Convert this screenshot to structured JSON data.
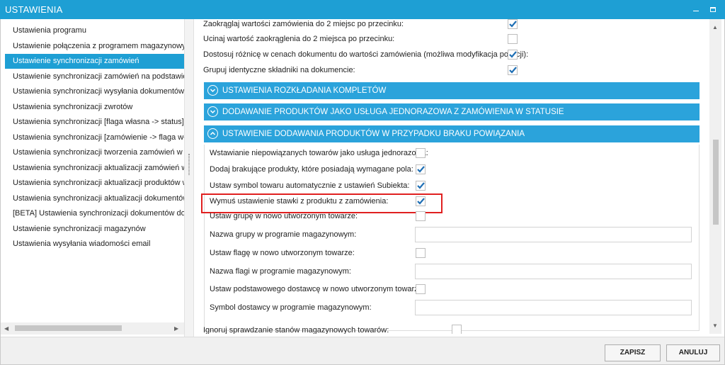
{
  "window": {
    "title": "USTAWIENIA"
  },
  "sidebar": {
    "items": [
      {
        "label": "Ustawienia programu"
      },
      {
        "label": "Ustawienie połączenia z programem magazynowym"
      },
      {
        "label": "Ustawienie synchronizacji zamówień",
        "active": true
      },
      {
        "label": "Ustawienie synchronizacji zamówień na podstawie dzi"
      },
      {
        "label": "Ustawienia synchronizacji wysyłania dokumentów"
      },
      {
        "label": "Ustawienia synchronizacji zwrotów"
      },
      {
        "label": "Ustawienia synchronizacji [flaga własna -> status]"
      },
      {
        "label": "Ustawienia synchronizacji [zamówienie -> flaga własn"
      },
      {
        "label": "Ustawienia synchronizacji tworzenia zamówień w Base"
      },
      {
        "label": "Ustawienia synchronizacji aktualizacji zamówień w Bas"
      },
      {
        "label": "Ustawienia synchronizacji aktualizacji produktów w Ba"
      },
      {
        "label": "Ustawienia synchronizacji aktualizacji dokumentów"
      },
      {
        "label": "[BETA] Ustawienia synchronizacji dokumentów dostaw"
      },
      {
        "label": "Ustawienie synchronizacji magazynów"
      },
      {
        "label": "Ustawienia wysyłania wiadomości email"
      }
    ]
  },
  "top_rows": [
    {
      "label": "Zaokrąglaj wartości zamówienia do 2 miejsc po przecinku:",
      "checked": true
    },
    {
      "label": "Ucinaj wartość zaokrąglenia do 2 miejsca po przecinku:",
      "checked": false
    },
    {
      "label": "Dostosuj różnicę w cenach dokumentu do wartości zamówienia (możliwa modyfikacja pozycji):",
      "checked": true
    },
    {
      "label": "Grupuj identyczne składniki na dokumencie:",
      "checked": true
    }
  ],
  "sections": [
    {
      "label": "USTAWIENIA ROZKŁADANIA KOMPLETÓW",
      "expanded": false
    },
    {
      "label": "DODAWANIE PRODUKTÓW JAKO USŁUGA JEDNORAZOWA Z ZAMÓWIENIA W STATUSIE",
      "expanded": false
    },
    {
      "label": "USTAWIENIE DODAWANIA PRODUKTÓW W PRZYPADKU BRAKU POWIĄZANIA",
      "expanded": true
    }
  ],
  "section_rows": [
    {
      "label": "Wstawianie niepowiązanych towarów jako usługa jednorazowa:",
      "type": "checkbox",
      "checked": false
    },
    {
      "label": "Dodaj brakujące produkty, które posiadają wymagane pola:",
      "type": "checkbox",
      "checked": true
    },
    {
      "label": "Ustaw symbol towaru automatycznie z ustawień Subiekta:",
      "type": "checkbox",
      "checked": true,
      "highlighted": true
    },
    {
      "label": "Wymuś ustawienie stawki z produktu z zamówienia:",
      "type": "checkbox",
      "checked": true
    },
    {
      "label": "Ustaw grupę w nowo utworzonym towarze:",
      "type": "checkbox",
      "checked": false
    },
    {
      "label": "Nazwa grupy w programie magazynowym:",
      "type": "text",
      "value": ""
    },
    {
      "label": "Ustaw flagę w nowo utworzonym towarze:",
      "type": "checkbox",
      "checked": false
    },
    {
      "label": "Nazwa flagi w programie magazynowym:",
      "type": "text",
      "value": ""
    },
    {
      "label": "Ustaw podstawowego dostawcę w nowo utworzonym towarze:",
      "type": "checkbox",
      "checked": false
    },
    {
      "label": "Symbol dostawcy w programie magazynowym:",
      "type": "text",
      "value": ""
    }
  ],
  "bottom_row": {
    "label": "Ignoruj sprawdzanie stanów magazynowych towarów:",
    "checked": false
  },
  "footer": {
    "save_label": "ZAPISZ",
    "cancel_label": "ANULUJ"
  },
  "colors": {
    "accent": "#1e9fd4",
    "section_header": "#2ba3db",
    "highlight": "#e02020",
    "check": "#1f6fb5"
  }
}
